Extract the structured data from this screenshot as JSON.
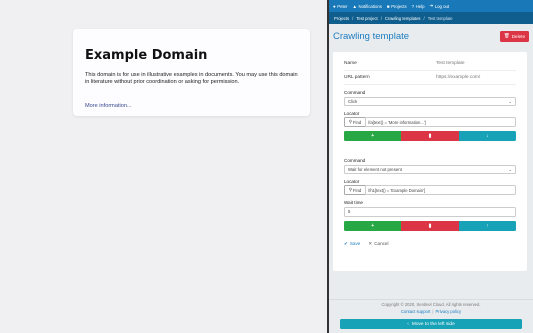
{
  "page": {
    "title": "Example Domain",
    "body": "This domain is for use in illustrative examples in documents. You may use this domain in literature without prior coordination or asking for permission.",
    "link": "More information..."
  },
  "topbar": {
    "items": [
      {
        "label": "Peter",
        "icon": "user-icon"
      },
      {
        "label": "Notifications",
        "icon": "bell-icon"
      },
      {
        "label": "Projects",
        "icon": "briefcase-icon"
      },
      {
        "label": "Help",
        "icon": "question-icon"
      },
      {
        "label": "Log out",
        "icon": "logout-icon"
      }
    ]
  },
  "breadcrumb": {
    "items": [
      "Projects",
      "Test project",
      "Crawling templates",
      "Test template"
    ]
  },
  "header": {
    "title": "Crawling template",
    "delete_label": "Delete"
  },
  "details": {
    "name_label": "Name",
    "name_value": "Test template",
    "url_label": "URL pattern",
    "url_value": "https://example.com/"
  },
  "steps": [
    {
      "command_label": "Command",
      "command_value": "Click",
      "locator_label": "Locator",
      "find_label": "Find",
      "locator_value": "//a[text() = 'More information...']"
    },
    {
      "command_label": "Command",
      "command_value": "Wait for element not present",
      "locator_label": "Locator",
      "find_label": "Find",
      "locator_value": "//h1[text() = 'Example Domain']",
      "wait_label": "Wait time",
      "wait_value": "5"
    }
  ],
  "actions": {
    "save": "Save",
    "cancel": "Cancel"
  },
  "footer": {
    "copyright": "Copyright © 2020, Sentinel Cloud. All rights reserved.",
    "support": "Contact support",
    "privacy": "Privacy policy",
    "move_left": "Move to the left side"
  },
  "colors": {
    "topbar": "#1979b8",
    "breadcrumb": "#0f5e8e",
    "accent": "#1b7cc0",
    "danger": "#dc3545",
    "success": "#28a745",
    "info": "#17a2b8"
  }
}
